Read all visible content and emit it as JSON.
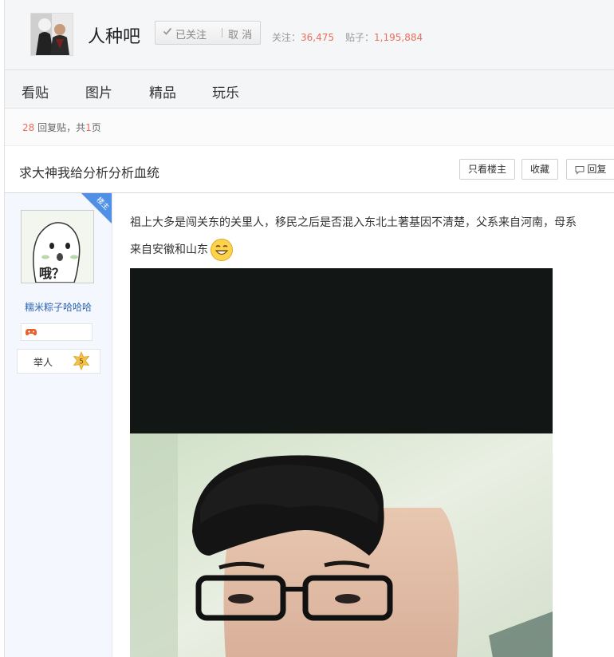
{
  "forum": {
    "name": "人种吧",
    "follow_state": "已关注",
    "cancel_label": "取 消",
    "follow_count_label": "关注：",
    "follow_count": "36,475",
    "post_count_label": "贴子：",
    "post_count": "1,195,884"
  },
  "tabs": [
    {
      "label": "看贴"
    },
    {
      "label": "图片"
    },
    {
      "label": "精品"
    },
    {
      "label": "玩乐"
    }
  ],
  "reply_bar": {
    "reply_count": "28",
    "reply_suffix": "回复贴，共",
    "page_count": "1",
    "page_suffix": "页"
  },
  "thread": {
    "title": "求大神我给分析分析血统",
    "buttons": {
      "only_op": "只看楼主",
      "favorite": "收藏",
      "reply": "回复"
    }
  },
  "author": {
    "badge": "楼主",
    "avatar_caption": "哦？",
    "name": "糯米粽子哈哈哈",
    "level_title": "举人",
    "level": "5"
  },
  "post": {
    "line1": "祖上大多是闯关东的关里人，移民之后是否混入东北土著基因不清楚，父系来自河南，母系",
    "line2": "来自安徽和山东",
    "emoji": "grin-emoji"
  },
  "colors": {
    "accent_number": "#ea6f5a",
    "link_blue": "#2d64b3",
    "badge_blue": "#4f8fe6",
    "level_star": "#f2c24a"
  }
}
